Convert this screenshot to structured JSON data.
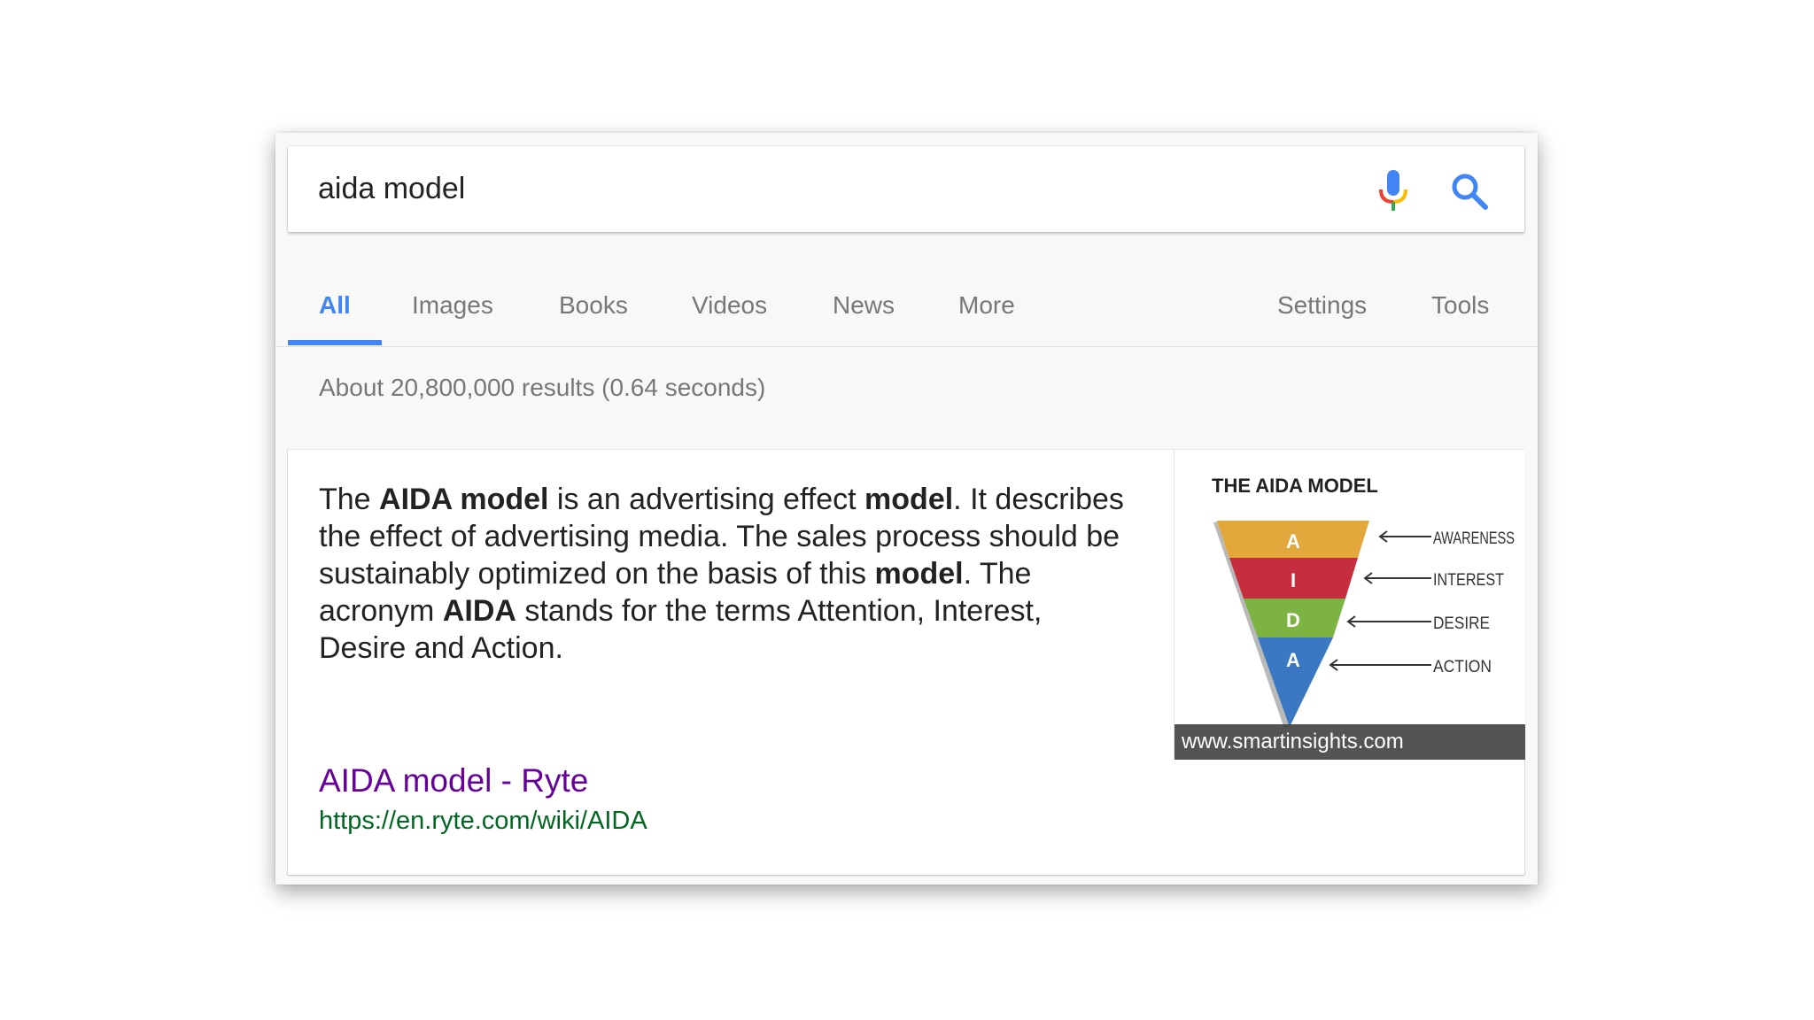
{
  "search": {
    "query": "aida model"
  },
  "tabs": [
    {
      "label": "All",
      "active": true
    },
    {
      "label": "Images"
    },
    {
      "label": "Books"
    },
    {
      "label": "Videos"
    },
    {
      "label": "News"
    },
    {
      "label": "More"
    },
    {
      "label": "Settings"
    },
    {
      "label": "Tools"
    }
  ],
  "stats": "About 20,800,000 results (0.64 seconds)",
  "snippet": {
    "segments": [
      {
        "text": "The ",
        "bold": false
      },
      {
        "text": "AIDA model",
        "bold": true
      },
      {
        "text": " is an advertising effect ",
        "bold": false
      },
      {
        "text": "model",
        "bold": true
      },
      {
        "text": ". It describes the effect of advertising media. The sales process should be sustainably optimized on the basis of this ",
        "bold": false
      },
      {
        "text": "model",
        "bold": true
      },
      {
        "text": ". The acronym ",
        "bold": false
      },
      {
        "text": "AIDA",
        "bold": true
      },
      {
        "text": " stands for the terms Attention, Interest, Desire and Action.",
        "bold": false
      }
    ]
  },
  "result": {
    "title": "AIDA model - Ryte",
    "url": "https://en.ryte.com/wiki/AIDA"
  },
  "image": {
    "title": "THE AIDA MODEL",
    "caption": "www.smartinsights.com",
    "levels": [
      {
        "letter": "A",
        "label": "AWARENESS",
        "color": "#e3a83b"
      },
      {
        "letter": "I",
        "label": "INTEREST",
        "color": "#c62d3e"
      },
      {
        "letter": "D",
        "label": "DESIRE",
        "color": "#7cb342"
      },
      {
        "letter": "A",
        "label": "ACTION",
        "color": "#3b78c2"
      }
    ]
  },
  "colors": {
    "accent": "#4285f4",
    "visited_link": "#660099",
    "url_green": "#006621"
  }
}
